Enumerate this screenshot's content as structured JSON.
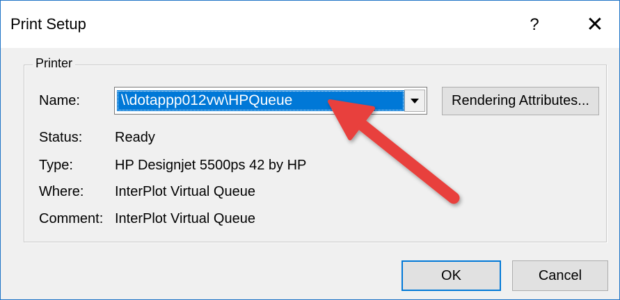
{
  "window": {
    "title": "Print Setup",
    "help_label": "?",
    "close_label": "✕"
  },
  "printer_group": {
    "legend": "Printer",
    "name_label": "Name:",
    "name_value": "\\\\dotappp012vw\\HPQueue",
    "rendering_button": "Rendering Attributes...",
    "rows": [
      {
        "label": "Status:",
        "value": "Ready"
      },
      {
        "label": "Type:",
        "value": "HP Designjet 5500ps 42 by HP"
      },
      {
        "label": "Where:",
        "value": "InterPlot Virtual Queue"
      },
      {
        "label": "Comment:",
        "value": "InterPlot Virtual Queue"
      }
    ]
  },
  "buttons": {
    "ok": "OK",
    "cancel": "Cancel"
  },
  "colors": {
    "selection": "#0078d7",
    "annotation_arrow": "#e8413c"
  },
  "annotation": {
    "icon": "red-arrow-pointing-to-name"
  }
}
